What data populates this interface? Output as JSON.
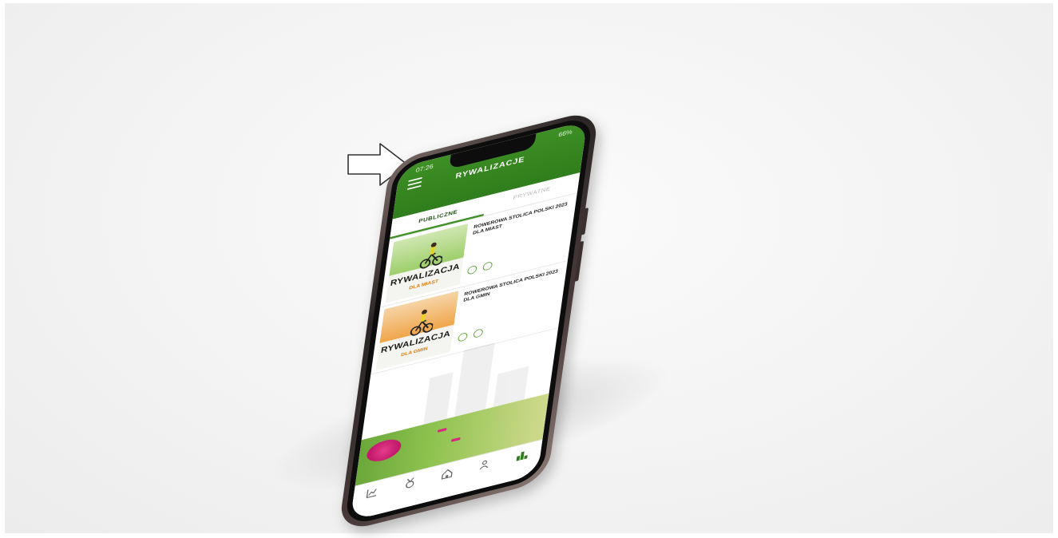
{
  "status_bar": {
    "time": "07:26",
    "battery": "66%"
  },
  "header": {
    "title": "RYWALIZACJE"
  },
  "tabs": [
    {
      "label": "PUBLICZNE",
      "active": true
    },
    {
      "label": "PRYWATNE",
      "active": false
    }
  ],
  "challenges": [
    {
      "thumb_title": "RYWALIZACJA",
      "thumb_subtitle": "DLA MIAST",
      "title": "ROWEROWA STOLICA POLSKI 2023 DLA MIAST",
      "icons": [
        "bike-icon",
        "bike-icon"
      ],
      "theme": "green"
    },
    {
      "thumb_title": "RYWALIZACJA",
      "thumb_subtitle": "DLA GMIN",
      "title": "ROWEROWA STOLICA POLSKI 2023 DLA GMIN",
      "icons": [
        "bike-icon",
        "bike-icon"
      ],
      "theme": "orange"
    }
  ],
  "banner": {
    "pill_1": "",
    "pill_2": ""
  },
  "bottom_nav": [
    {
      "icon": "chart-icon",
      "label": "",
      "active": false
    },
    {
      "icon": "medal-icon",
      "label": "",
      "active": false
    },
    {
      "icon": "home-icon",
      "label": "",
      "active": false
    },
    {
      "icon": "group-icon",
      "label": "",
      "active": false
    },
    {
      "icon": "ranking-icon",
      "label": "",
      "active": true
    }
  ],
  "colors": {
    "brand_green": "#3e8f25",
    "accent_orange": "#e07c12",
    "banner_pink": "#d62a7e"
  }
}
